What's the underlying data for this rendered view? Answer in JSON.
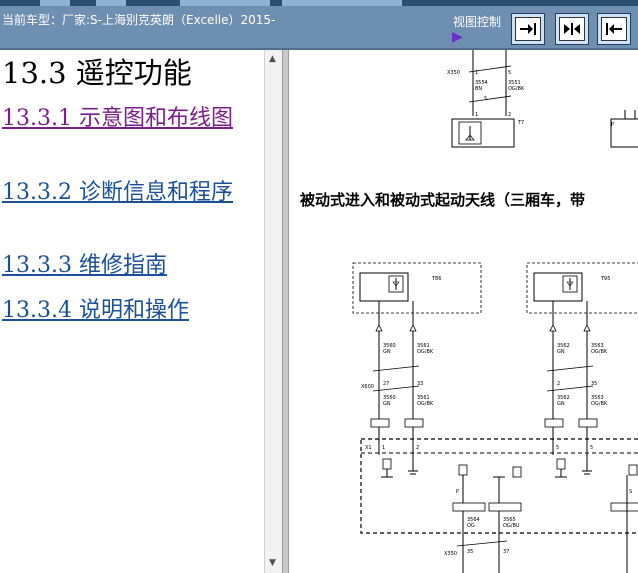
{
  "header": {
    "car_model": "当前车型：厂家:S-上海别克英朗（Excelle）2015-",
    "view_control_label": "视图控制",
    "buttons": [
      {
        "name": "collapse-left-pane-button",
        "icon": "arrow-right-to-bar-icon"
      },
      {
        "name": "split-view-button",
        "icon": "double-arrow-icon"
      },
      {
        "name": "collapse-right-pane-button",
        "icon": "arrow-left-from-bar-icon"
      }
    ]
  },
  "colors": {
    "header_bg": "#6f8fb0",
    "link_visited": "#7a1e8a",
    "link": "#1a4f9a"
  },
  "toc": {
    "title": "13.3 遥控功能",
    "items": [
      {
        "label": "13.3.1 示意图和布线图",
        "visited": true
      },
      {
        "label": "13.3.2 诊断信息和程序",
        "visited": false
      },
      {
        "label": "13.3.3 维修指南",
        "visited": false
      },
      {
        "label": "13.3.4 说明和操作",
        "visited": false
      }
    ]
  },
  "document": {
    "section_heading": "被动式进入和被动式起动天线（三厢车，带",
    "diagram_top_labels": [
      "X350",
      "1",
      "5",
      "2",
      "3",
      "3554",
      "BN",
      "3551",
      "OG/BK",
      "1",
      "2",
      "T7",
      "S",
      "P"
    ],
    "antenna_left": {
      "connector_id": "T86",
      "wires": [
        {
          "circuit": "3560",
          "color": "GN"
        },
        {
          "circuit": "3561",
          "color": "OG/BK"
        }
      ],
      "pins_x600": [
        "27",
        "33"
      ],
      "wires_lower": [
        {
          "circuit": "3560",
          "color": "GN"
        },
        {
          "circuit": "3561",
          "color": "OG/BK"
        }
      ],
      "connector_bottom": "X1",
      "bottom_pins": [
        "1",
        "2"
      ]
    },
    "antenna_right": {
      "connector_id": "T95",
      "wires": [
        {
          "circuit": "3562",
          "color": "GN"
        },
        {
          "circuit": "3563",
          "color": "OG/BK"
        }
      ],
      "pins_x600": [
        "2",
        "35"
      ],
      "wires_lower": [
        {
          "circuit": "3562",
          "color": "GN"
        },
        {
          "circuit": "3563",
          "color": "OG/BK"
        }
      ],
      "connector_bottom": "X1",
      "bottom_pins": [
        "5",
        "5"
      ]
    },
    "bottom_wires": [
      {
        "circuit": "3564",
        "color": "OG"
      },
      {
        "circuit": "3565",
        "color": "OG/BU"
      }
    ],
    "bottom_pins": [
      "35",
      "37"
    ],
    "bottom_connector": "X350",
    "labels_misc": [
      "P",
      "S",
      "X600",
      "X1"
    ]
  }
}
